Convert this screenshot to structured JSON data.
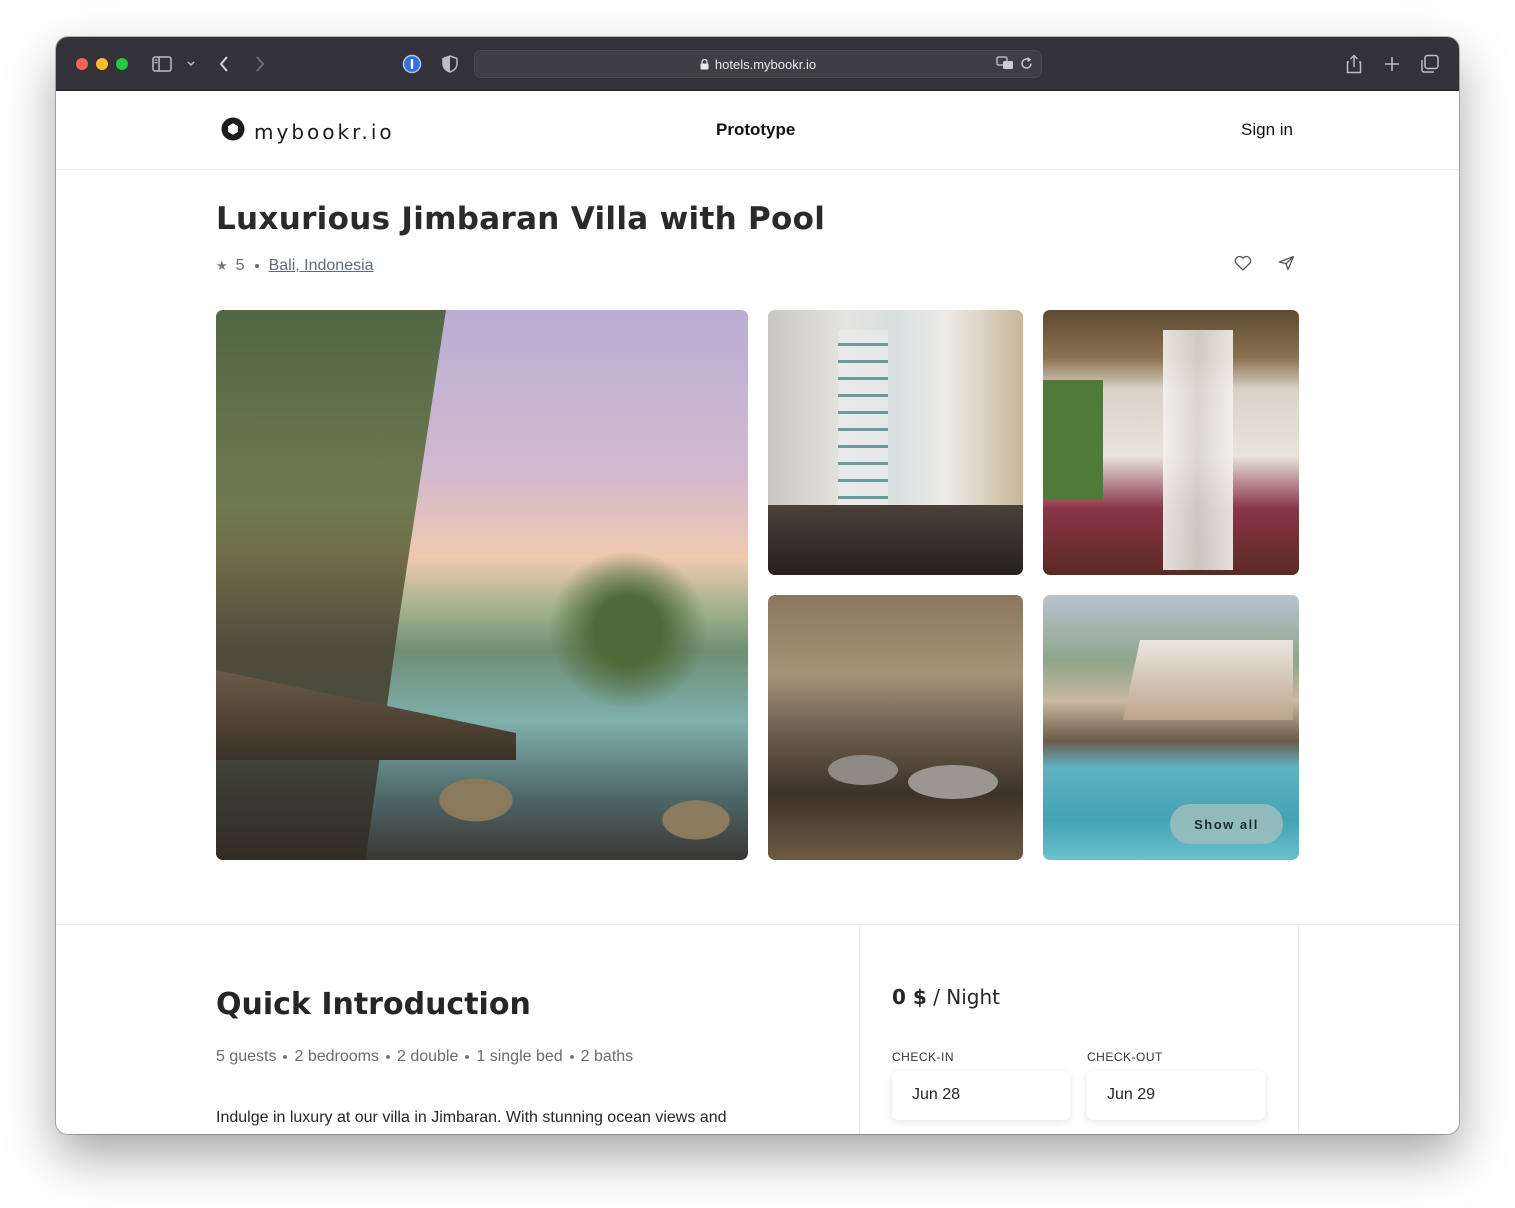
{
  "browser": {
    "url": "hotels.mybookr.io"
  },
  "nav": {
    "logo_text": "mybookr.io",
    "center_label": "Prototype",
    "signin_label": "Sign in"
  },
  "listing": {
    "title": "Luxurious Jimbaran Villa with Pool",
    "rating": "5",
    "location": "Bali, Indonesia",
    "show_all_label": "Show all"
  },
  "intro": {
    "heading": "Quick Introduction",
    "stats": [
      "5 guests",
      "2 bedrooms",
      "2 double",
      "1 single bed",
      "2 baths"
    ],
    "description": "Indulge in luxury at our villa in Jimbaran. With stunning ocean views and"
  },
  "booking": {
    "price": "0 $",
    "per_night": "/ Night",
    "checkin_label": "CHECK-IN",
    "checkout_label": "CHECK-OUT",
    "checkin_value": "Jun 28",
    "checkout_value": "Jun 29"
  },
  "icons": {
    "sidebar": "sidebar-icon",
    "back": "chevron-left-icon",
    "forward": "chevron-right-icon",
    "password": "password-manager-icon",
    "shield": "shield-icon",
    "lock": "lock-icon",
    "translate": "translate-icon",
    "reload": "reload-icon",
    "share": "share-icon",
    "new_tab": "plus-icon",
    "tabs": "tabs-overview-icon",
    "heart": "heart-icon",
    "send": "send-icon",
    "star": "star-icon"
  }
}
